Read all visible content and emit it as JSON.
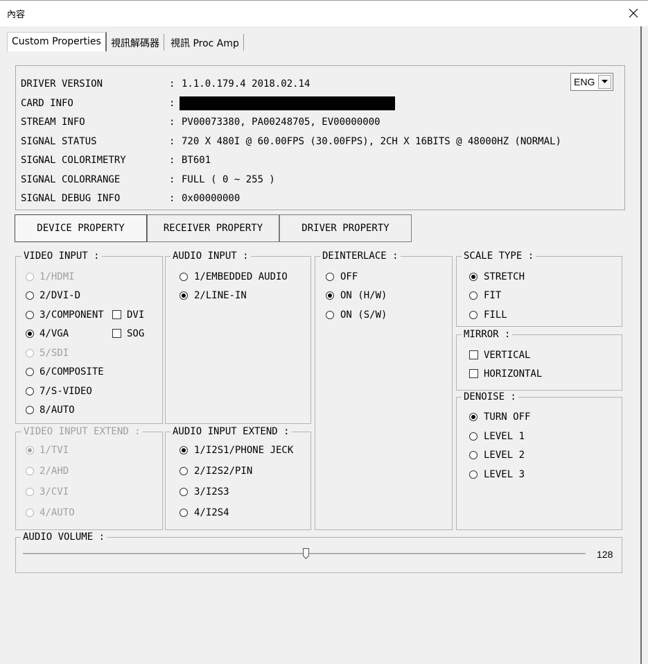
{
  "window": {
    "title": "內容"
  },
  "tabs": [
    {
      "label": "Custom Properties",
      "active": true
    },
    {
      "label": "視訊解碼器",
      "active": false
    },
    {
      "label": "視訊 Proc Amp",
      "active": false
    }
  ],
  "info": {
    "rows": [
      {
        "label": "DRIVER VERSION",
        "value": "1.1.0.179.4 2018.02.14"
      },
      {
        "label": "CARD INFO",
        "value": ""
      },
      {
        "label": "STREAM INFO",
        "value": "PV00073380, PA00248705, EV00000000"
      },
      {
        "label": "SIGNAL STATUS",
        "value": "720 X 480I @ 60.00FPS (30.00FPS), 2CH X 16BITS @ 48000HZ (NORMAL)"
      },
      {
        "label": "SIGNAL COLORIMETRY",
        "value": "BT601"
      },
      {
        "label": "SIGNAL COLORRANGE",
        "value": "FULL ( 0 ~ 255 )"
      },
      {
        "label": "SIGNAL DEBUG INFO",
        "value": "0x00000000"
      }
    ],
    "colon": ":",
    "language": "ENG"
  },
  "property_buttons": {
    "device": "DEVICE PROPERTY",
    "receiver": "RECEIVER PROPERTY",
    "driver": "DRIVER PROPERTY"
  },
  "video_input": {
    "label": "VIDEO INPUT :",
    "options": [
      "1/HDMI",
      "2/DVI-D",
      "3/COMPONENT",
      "4/VGA",
      "5/SDI",
      "6/COMPOSITE",
      "7/S-VIDEO",
      "8/AUTO"
    ],
    "selected": "4/VGA",
    "dvi_label": "DVI",
    "sog_label": "SOG"
  },
  "video_input_extend": {
    "label": "VIDEO INPUT EXTEND :",
    "options": [
      "1/TVI",
      "2/AHD",
      "3/CVI",
      "4/AUTO"
    ],
    "selected": "1/TVI"
  },
  "audio_input": {
    "label": "AUDIO INPUT :",
    "options": [
      "1/EMBEDDED AUDIO",
      "2/LINE-IN"
    ],
    "selected": "2/LINE-IN"
  },
  "audio_input_extend": {
    "label": "AUDIO INPUT EXTEND :",
    "options": [
      "1/I2S1/PHONE JECK",
      "2/I2S2/PIN",
      "3/I2S3",
      "4/I2S4"
    ],
    "selected": "1/I2S1/PHONE JECK"
  },
  "deinterlace": {
    "label": "DEINTERLACE :",
    "options": [
      "OFF",
      "ON (H/W)",
      "ON (S/W)"
    ],
    "selected": "ON (H/W)"
  },
  "scale_type": {
    "label": "SCALE TYPE :",
    "options": [
      "STRETCH",
      "FIT",
      "FILL"
    ],
    "selected": "STRETCH"
  },
  "mirror": {
    "label": "MIRROR :",
    "options": [
      "VERTICAL",
      "HORIZONTAL"
    ]
  },
  "denoise": {
    "label": "DENOISE :",
    "options": [
      "TURN OFF",
      "LEVEL 1",
      "LEVEL 2",
      "LEVEL 3"
    ],
    "selected": "TURN OFF"
  },
  "audio_volume": {
    "label": "AUDIO VOLUME :",
    "value": "128",
    "max": 255
  }
}
